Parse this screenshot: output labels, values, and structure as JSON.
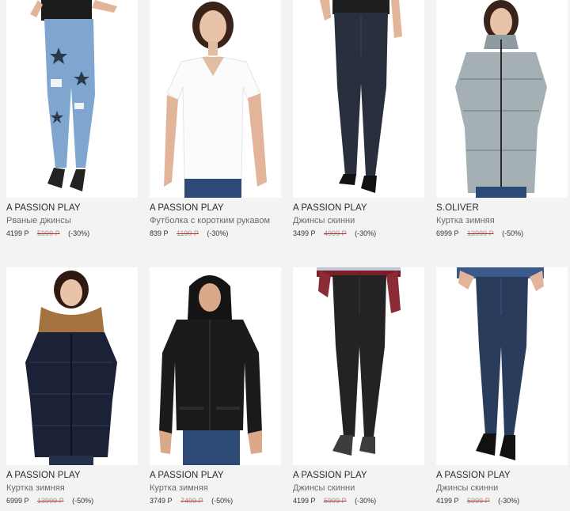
{
  "products": [
    {
      "brand": "A PASSION PLAY",
      "title": "Рваные джинсы",
      "price": "4199 Р",
      "old_price": "5999 Р",
      "discount": "(-30%)",
      "icon": "ripped-jeans-model-photo"
    },
    {
      "brand": "A PASSION PLAY",
      "title": "Футболка с коротким рукавом",
      "price": "839 Р",
      "old_price": "1199 Р",
      "discount": "(-30%)",
      "icon": "white-tshirt-model-photo"
    },
    {
      "brand": "A PASSION PLAY",
      "title": "Джинсы скинни",
      "price": "3499 Р",
      "old_price": "4999 Р",
      "discount": "(-30%)",
      "icon": "dark-skinny-jeans-model-photo"
    },
    {
      "brand": "S.OLIVER",
      "title": "Куртка зимняя",
      "price": "6999 Р",
      "old_price": "13999 Р",
      "discount": "(-50%)",
      "icon": "silver-puffer-coat-model-photo"
    },
    {
      "brand": "A PASSION PLAY",
      "title": "Куртка зимняя",
      "price": "6999 Р",
      "old_price": "13999 Р",
      "discount": "(-50%)",
      "icon": "navy-fur-hood-coat-model-photo"
    },
    {
      "brand": "A PASSION PLAY",
      "title": "Куртка зимняя",
      "price": "3749 Р",
      "old_price": "7499 Р",
      "discount": "(-50%)",
      "icon": "black-hooded-jacket-model-photo"
    },
    {
      "brand": "A PASSION PLAY",
      "title": "Джинсы скинни",
      "price": "4199 Р",
      "old_price": "5999 Р",
      "discount": "(-30%)",
      "icon": "black-skinny-jeans-model-photo"
    },
    {
      "brand": "A PASSION PLAY",
      "title": "Джинсы скинни",
      "price": "4199 Р",
      "old_price": "5999 Р",
      "discount": "(-30%)",
      "icon": "blue-skinny-jeans-model-photo"
    }
  ],
  "colors": {
    "background": "#f3f3f3",
    "card": "#ffffff",
    "strike": "#cc2222"
  }
}
